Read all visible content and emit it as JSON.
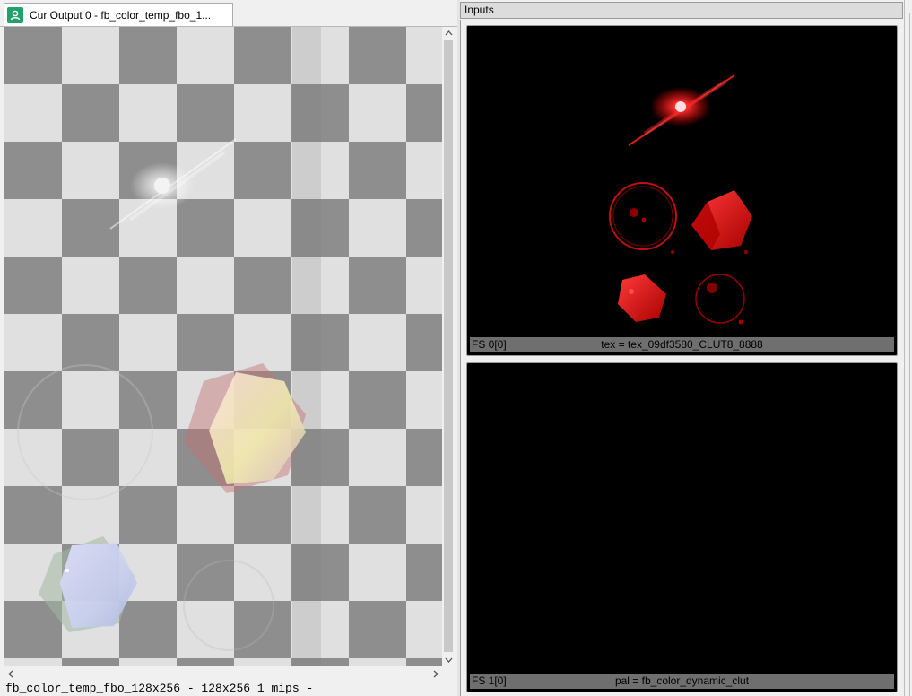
{
  "tab": {
    "title": "Cur Output 0 - fb_color_temp_fbo_1..."
  },
  "main": {
    "status": "fb_color_temp_fbo_128x256 - 128x256 1 mips -"
  },
  "inputs": {
    "header": "Inputs",
    "slots": [
      {
        "slot": "FS 0[0]",
        "name": "tex = tex_09df3580_CLUT8_8888"
      },
      {
        "slot": "FS 1[0]",
        "name": "pal = fb_color_dynamic_clut"
      }
    ]
  },
  "colors": {
    "checker_light": "#e0e0e0",
    "checker_dark": "#8e8e8e",
    "tab_icon": "#23a16b",
    "thumb_bg": "#000000",
    "thumb_label_bg": "#6f6f6f",
    "flare_red": "#ff1010"
  }
}
